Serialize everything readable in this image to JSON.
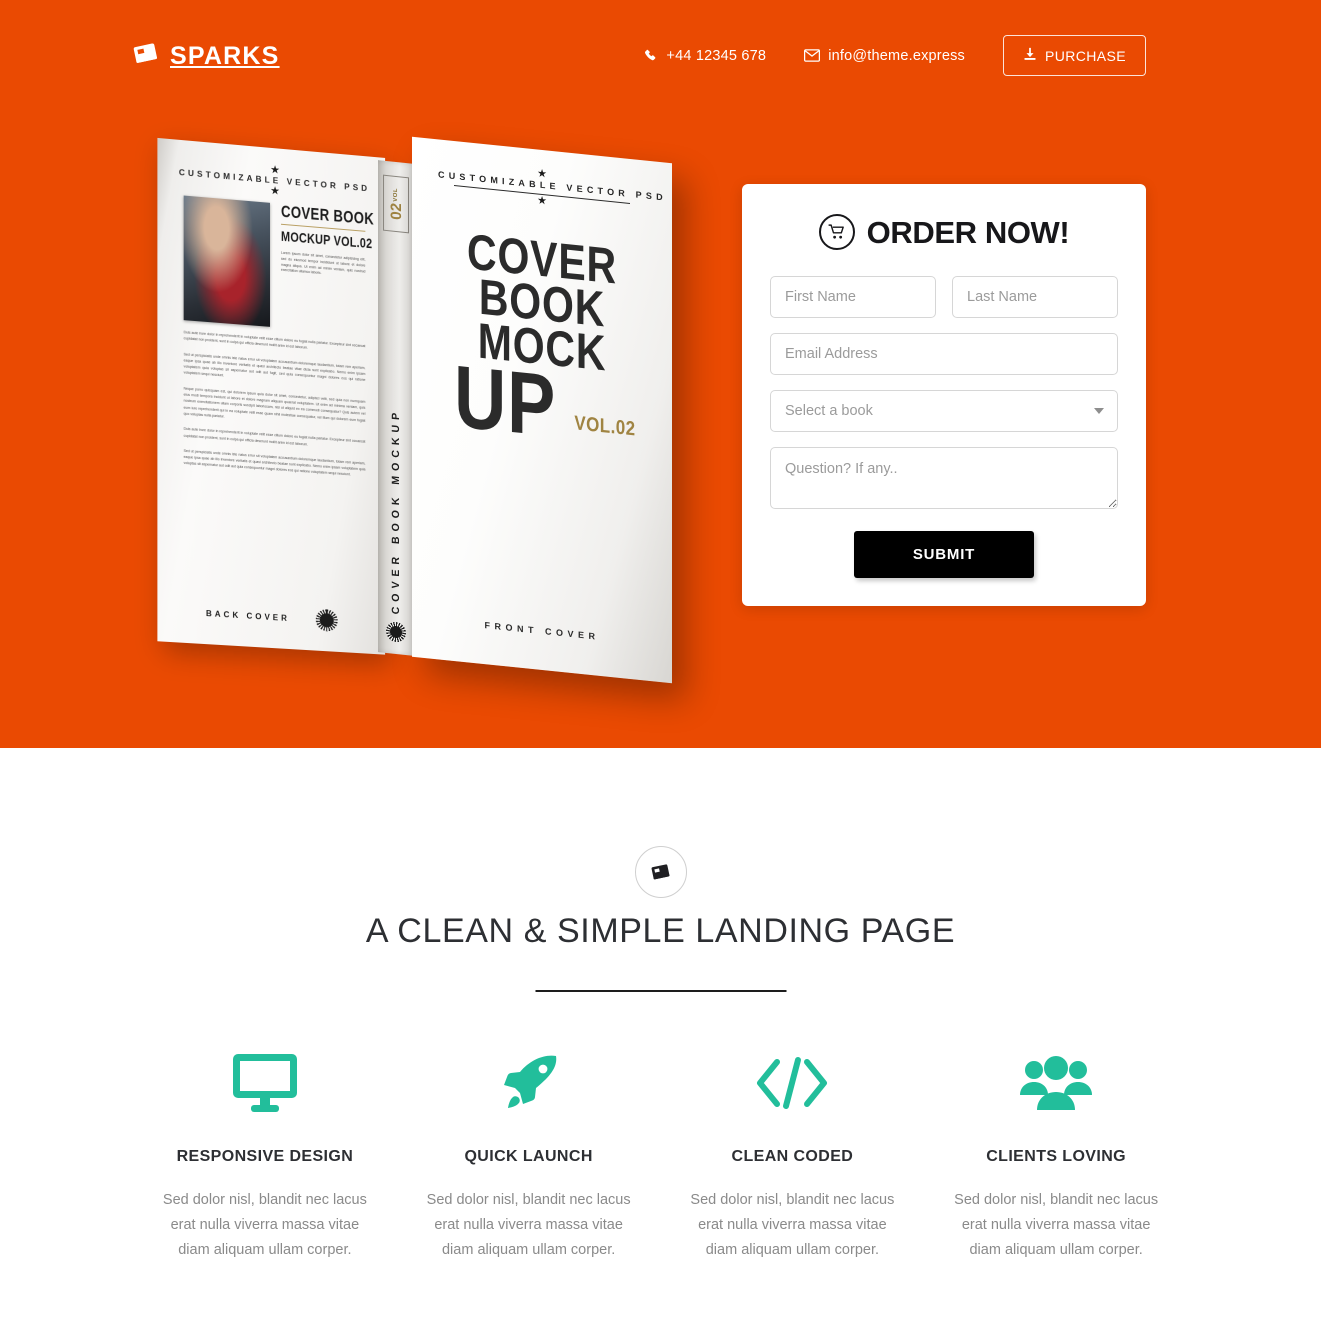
{
  "colors": {
    "brand_orange": "#ea4a02",
    "accent_teal": "#22be9b",
    "dark": "#17171a",
    "muted_text": "#8a8a8a"
  },
  "header": {
    "logo_text": "SPARKS",
    "logo_icon": "book-icon",
    "phone": "+44 12345 678",
    "phone_icon": "phone-icon",
    "email": "info@theme.express",
    "email_icon": "envelope-icon",
    "purchase_label": "PURCHASE",
    "purchase_icon": "download-icon"
  },
  "book": {
    "front": {
      "top_label": "CUSTOMIZABLE VECTOR PSD",
      "title_line1": "COVER",
      "title_line2": "BOOK",
      "title_line3": "MOCK",
      "title_line4": "UP",
      "volume": "VOL.02",
      "bottom_label": "FRONT COVER"
    },
    "spine": {
      "vol_small": "VOL",
      "vol_number": "02",
      "text": "COVER BOOK MOCKUP"
    },
    "back": {
      "top_label": "CUSTOMIZABLE VECTOR PSD",
      "title": "COVER BOOK",
      "subtitle": "MOCKUP VOL.02",
      "intro": "Lorem ipsum dolor sit amet, consectetur adipisicing elit, sed do eiusmod tempor incididunt ut labore et dolore magna aliqua. Ut enim ad minim veniam, quis nostrud exercitation ullamco laboris.",
      "paragraph1": "Duis aute irure dolor in reprehenderit in voluptate velit esse cillum dolore eu fugiat nulla pariatur. Excepteur sint occaecat cupidatat non proident, sunt in culpa qui officia deserunt mollit anim id est laborum.",
      "paragraph2": "Sed ut perspiciatis unde omnis iste natus error sit voluptatem accusantium doloremque laudantium, totam rem aperiam, eaque ipsa quae ab illo inventore veritatis et quasi architecto beatae vitae dicta sunt explicabo. Nemo enim ipsam voluptatem quia voluptas sit aspernatur aut odit aut fugit, sed quia consequuntur magni dolores eos qui ratione voluptatem sequi nesciunt.",
      "paragraph3": "Neque porro quisquam est, qui dolorem ipsum quia dolor sit amet, consectetur, adipisci velit, sed quia non numquam eius modi tempora incidunt ut labore et dolore magnam aliquam quaerat voluptatem. Ut enim ad minima veniam, quis nostrum exercitationem ullam corporis suscipit laboriosam, nisi ut aliquid ex ea commodi consequatur? Quis autem vel eum iure reprehenderit qui in ea voluptate velit esse quam nihil molestiae consequatur, vel illum qui dolorem eum fugiat quo voluptas nulla pariatur.",
      "paragraph4": "Duis aute irure dolor in reprehenderit in voluptate velit esse cillum dolore eu fugiat nulla pariatur. Excepteur sint occaecat cupidatat non proident, sunt in culpa qui officia deserunt mollit anim id est laborum.",
      "paragraph5": "Sed ut perspiciatis unde omnis iste natus error sit voluptatem accusantium doloremque laudantium, totam rem aperiam, eaque ipsa quae ab illo inventore veritatis et quasi architecto beatae sunt explicabo. Nemo enim ipsam voluptatem quia voluptas sit aspernatur aut odit aut quia consequuntur magni dolores eos qui ratione voluptatem sequi nesciunt.",
      "bottom_label": "BACK COVER"
    }
  },
  "order_form": {
    "title": "ORDER NOW!",
    "title_icon": "shopping-cart-icon",
    "first_name_placeholder": "First Name",
    "first_name_value": "",
    "last_name_placeholder": "Last Name",
    "last_name_value": "",
    "email_placeholder": "Email Address",
    "email_value": "",
    "select_selected": "Select a book",
    "select_options": [
      "Select a book"
    ],
    "question_placeholder": "Question? If any..",
    "question_value": "",
    "submit_label": "SUBMIT"
  },
  "section": {
    "icon": "book-icon",
    "title": "A CLEAN & SIMPLE LANDING PAGE"
  },
  "features": [
    {
      "icon": "desktop-monitor-icon",
      "title": "RESPONSIVE DESIGN",
      "desc": "Sed dolor nisl, blandit nec lacus erat nulla viverra massa vitae diam aliquam ullam corper."
    },
    {
      "icon": "rocket-icon",
      "title": "QUICK LAUNCH",
      "desc": "Sed dolor nisl, blandit nec lacus erat nulla viverra massa vitae diam aliquam ullam corper."
    },
    {
      "icon": "code-brackets-icon",
      "title": "CLEAN CODED",
      "desc": "Sed dolor nisl, blandit nec lacus erat nulla viverra massa vitae diam aliquam ullam corper."
    },
    {
      "icon": "users-group-icon",
      "title": "CLIENTS LOVING",
      "desc": "Sed dolor nisl, blandit nec lacus erat nulla viverra massa vitae diam aliquam ullam corper."
    }
  ]
}
